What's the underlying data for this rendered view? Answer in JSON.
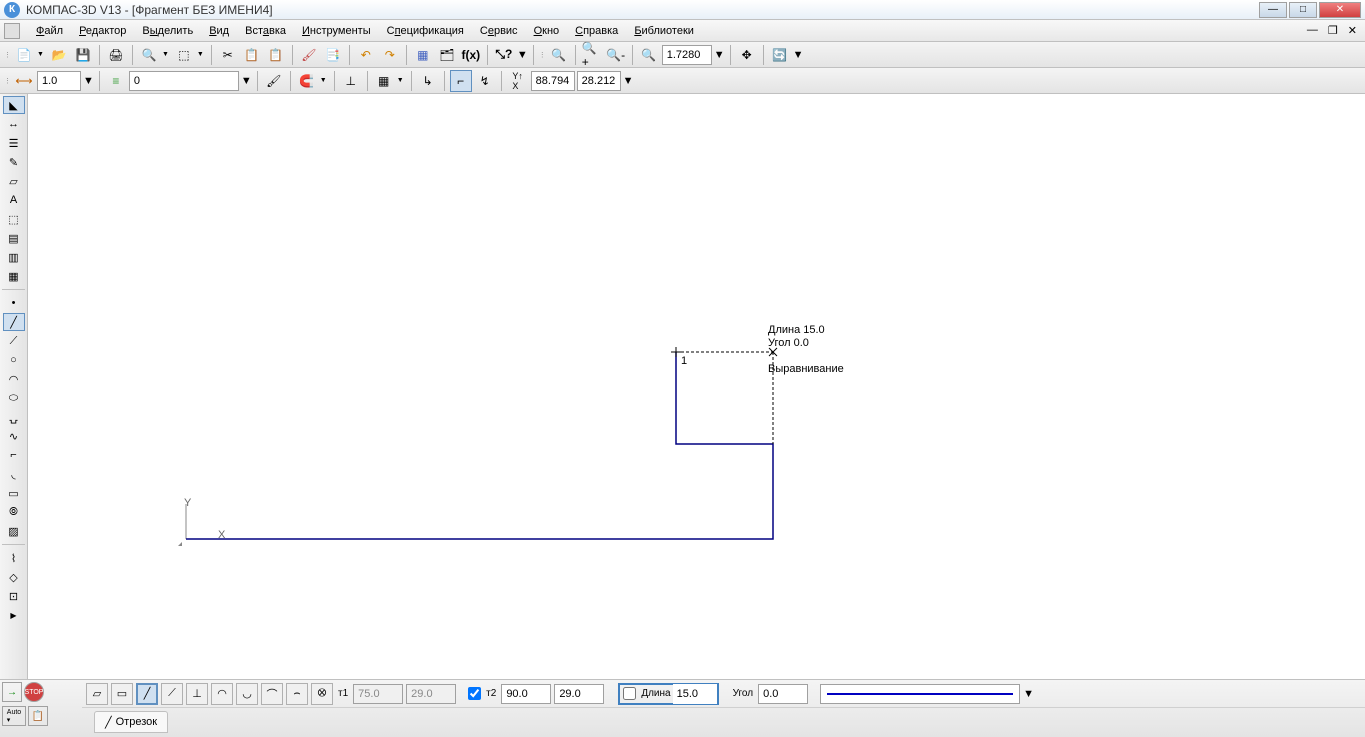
{
  "window": {
    "title": "КОМПАС-3D V13 - [Фрагмент БЕЗ ИМЕНИ4]"
  },
  "menu": {
    "items": [
      "Файл",
      "Редактор",
      "Выделить",
      "Вид",
      "Вставка",
      "Инструменты",
      "Спецификация",
      "Сервис",
      "Окно",
      "Справка",
      "Библиотеки"
    ]
  },
  "toolbar2": {
    "scale_value": "1.0",
    "layer_value": "0",
    "coord_x": "88.794",
    "coord_y": "28.212"
  },
  "zoom": {
    "value": "1.7280"
  },
  "canvas": {
    "hint_length": "Длина 15.0",
    "hint_angle": "Угол  0.0",
    "hint_align": "Выравнивание",
    "point_label": "1"
  },
  "params": {
    "t1_label": "т1",
    "t1_x": "75.0",
    "t1_y": "29.0",
    "t2_label": "т2",
    "t2_x": "90.0",
    "t2_y": "29.0",
    "length_label": "Длина",
    "length_value": "15.0",
    "angle_label": "Угол",
    "angle_value": "0.0",
    "tab_label": "Отрезок"
  }
}
